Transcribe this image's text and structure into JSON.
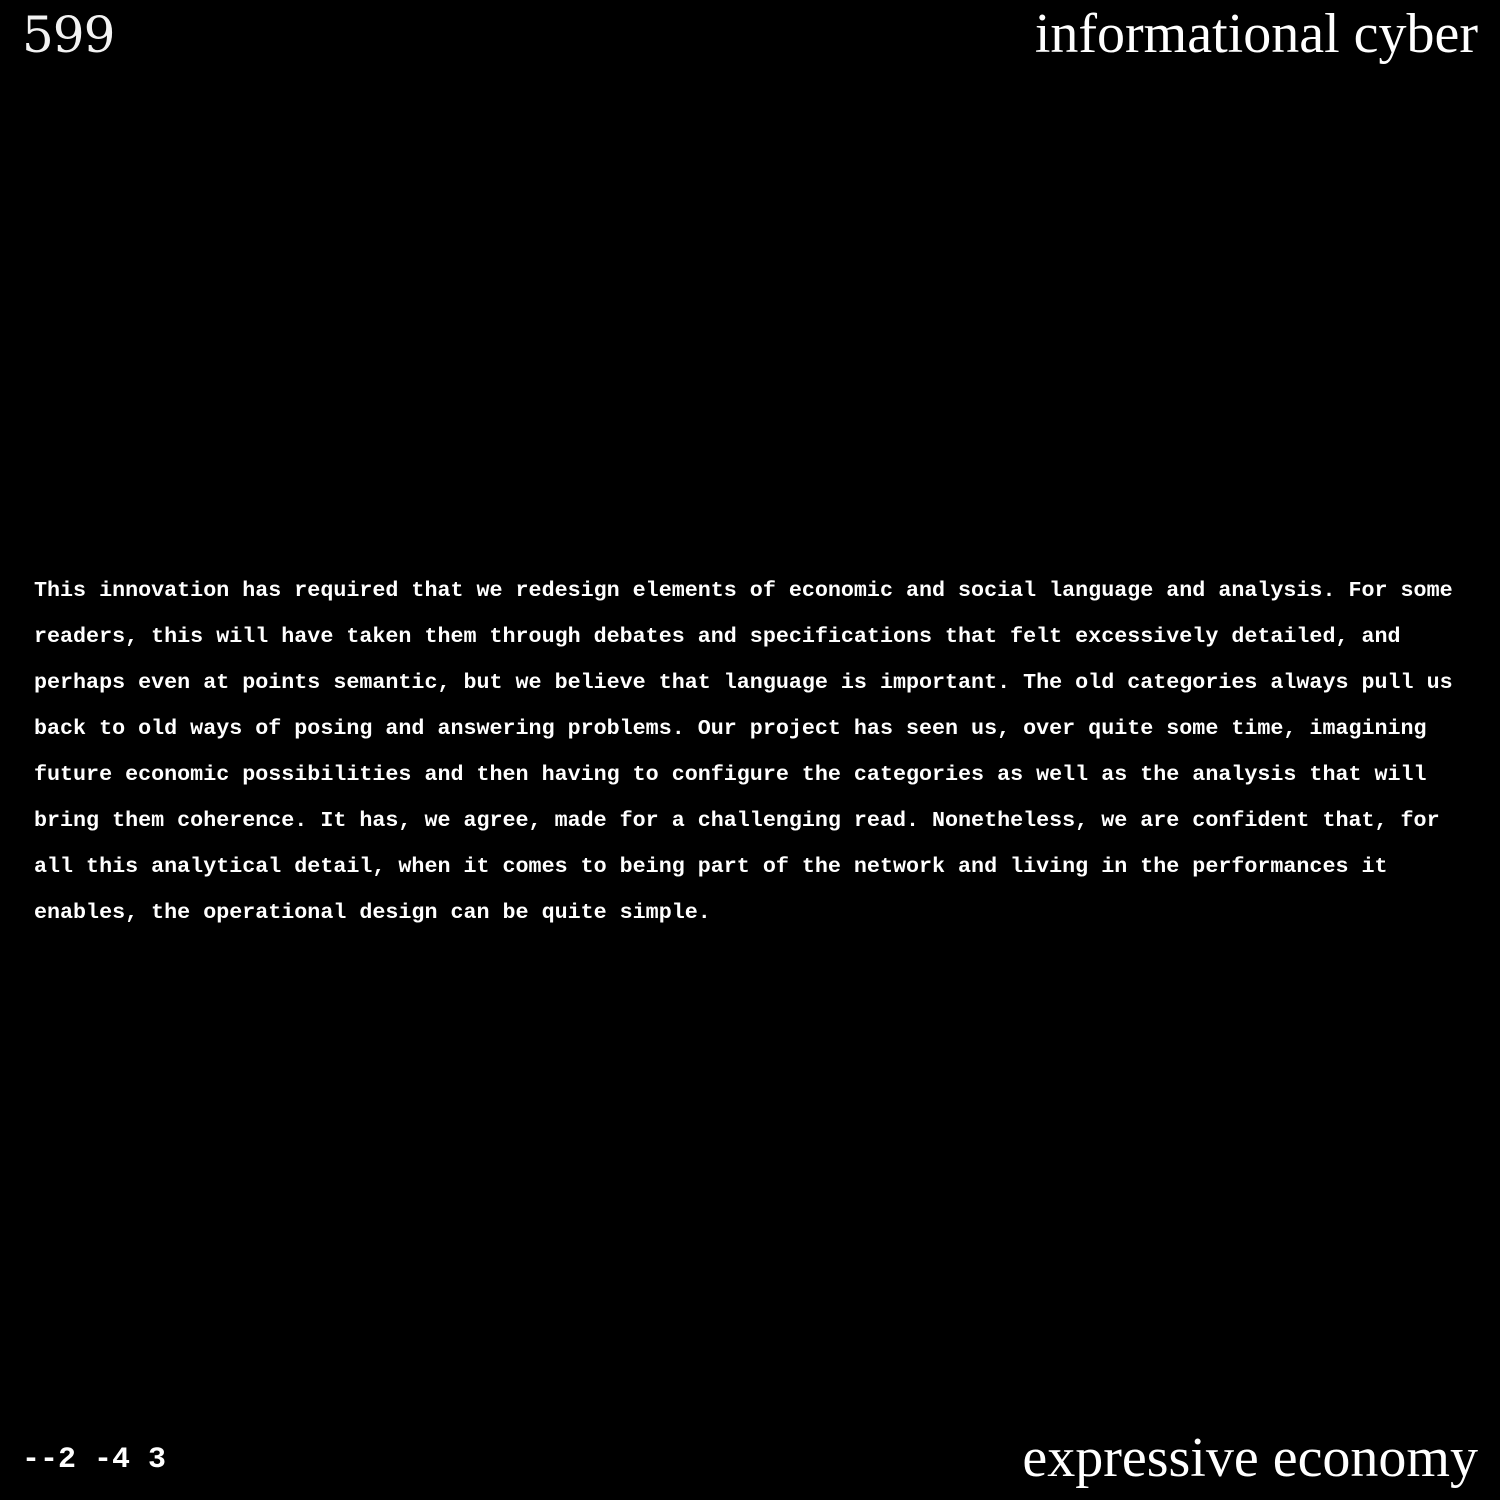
{
  "page": {
    "number": "599",
    "header_title": "informational cyber",
    "body": "This innovation has required that we redesign elements of economic and social language and analysis. For some readers, this will have taken them through debates and specifications that felt excessively detailed, and perhaps even at points semantic, but we believe that language is important. The old categories always pull us back to old ways of posing and answering problems. Our project has seen us, over quite some time, imagining future economic possibilities and then having to configure the categories as well as the analysis that will bring them coherence. It has, we agree, made for a challenging read. Nonetheless, we are confident that, for all this analytical detail, when it comes to being part of the network and living in the performances it enables, the operational design can be quite simple.",
    "footer_code": "--2 -4 3",
    "footer_title": "expressive economy"
  },
  "colors": {
    "background": "#000000",
    "text": "#ffffff"
  }
}
